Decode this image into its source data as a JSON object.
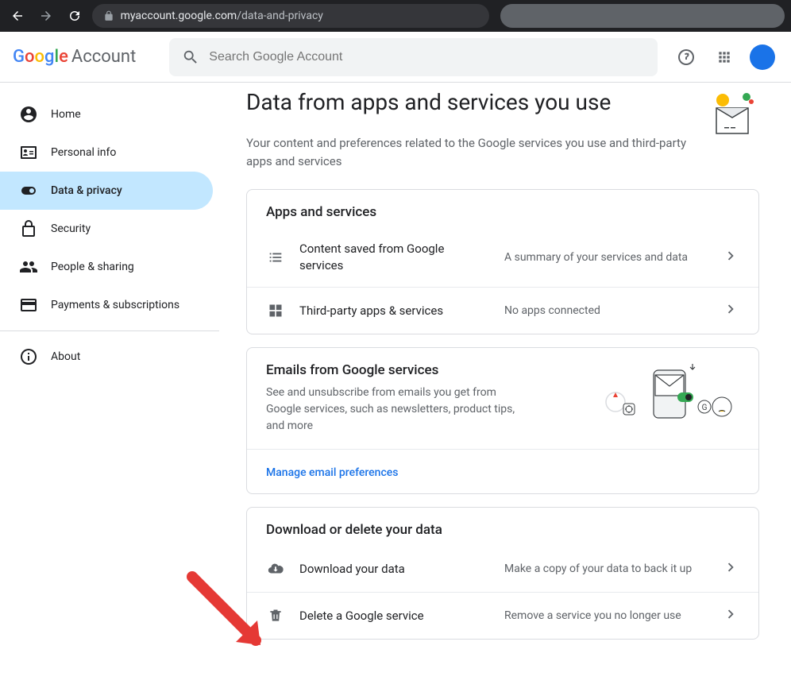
{
  "browser": {
    "url_host": "myaccount.google.com",
    "url_path": "/data-and-privacy"
  },
  "header": {
    "logo_word": [
      "G",
      "o",
      "o",
      "g",
      "l",
      "e"
    ],
    "account_word": "Account",
    "search_placeholder": "Search Google Account"
  },
  "sidebar": {
    "items": [
      {
        "label": "Home"
      },
      {
        "label": "Personal info"
      },
      {
        "label": "Data & privacy"
      },
      {
        "label": "Security"
      },
      {
        "label": "People & sharing"
      },
      {
        "label": "Payments & subscriptions"
      }
    ],
    "about_label": "About"
  },
  "page": {
    "title": "Data from apps and services you use",
    "subtitle": "Your content and preferences related to the Google services you use and third-party apps and services"
  },
  "apps_card": {
    "title": "Apps and services",
    "rows": [
      {
        "main": "Content saved from Google services",
        "desc": "A summary of your services and data"
      },
      {
        "main": "Third-party apps & services",
        "desc": "No apps connected"
      }
    ]
  },
  "emails_card": {
    "title": "Emails from Google services",
    "desc": "See and unsubscribe from emails you get from Google services, such as newsletters, product tips, and more",
    "link": "Manage email preferences"
  },
  "data_card": {
    "title": "Download or delete your data",
    "rows": [
      {
        "main": "Download your data",
        "desc": "Make a copy of your data to back it up"
      },
      {
        "main": "Delete a Google service",
        "desc": "Remove a service you no longer use"
      }
    ]
  }
}
